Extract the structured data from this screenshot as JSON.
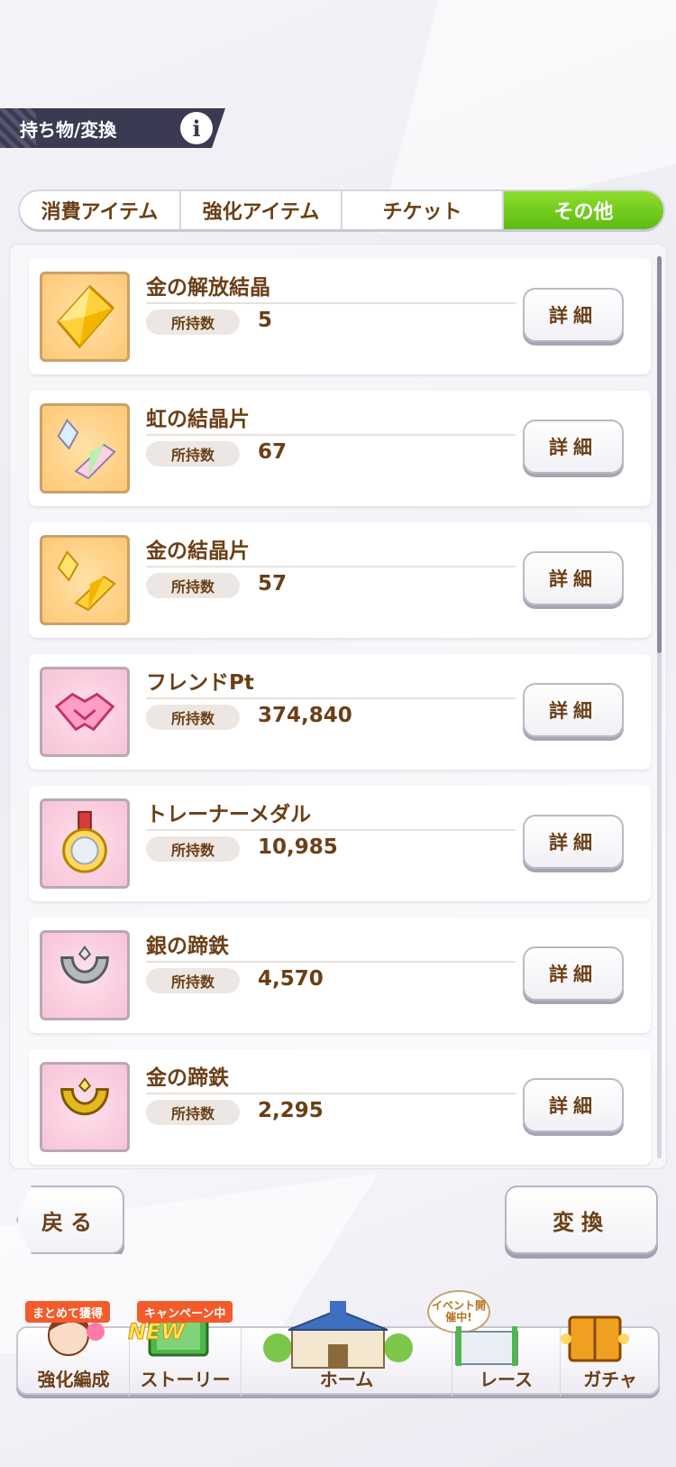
{
  "header": {
    "title": "持ち物/変換",
    "info_icon": "info-icon"
  },
  "tabs": [
    {
      "label": "消費アイテム",
      "active": false
    },
    {
      "label": "強化アイテム",
      "active": false
    },
    {
      "label": "チケット",
      "active": false
    },
    {
      "label": "その他",
      "active": true
    }
  ],
  "items": [
    {
      "name": "金の解放結晶",
      "qty_label": "所持数",
      "qty": "5",
      "icon": "gold-crystal-icon",
      "detail_label": "詳細"
    },
    {
      "name": "虹の結晶片",
      "qty_label": "所持数",
      "qty": "67",
      "icon": "rainbow-shard-icon",
      "detail_label": "詳細"
    },
    {
      "name": "金の結晶片",
      "qty_label": "所持数",
      "qty": "57",
      "icon": "gold-shard-icon",
      "detail_label": "詳細"
    },
    {
      "name": "フレンドPt",
      "qty_label": "所持数",
      "qty": "374,840",
      "icon": "handshake-icon",
      "detail_label": "詳細"
    },
    {
      "name": "トレーナーメダル",
      "qty_label": "所持数",
      "qty": "10,985",
      "icon": "medal-icon",
      "detail_label": "詳細"
    },
    {
      "name": "銀の蹄鉄",
      "qty_label": "所持数",
      "qty": "4,570",
      "icon": "silver-horseshoe-icon",
      "detail_label": "詳細"
    },
    {
      "name": "金の蹄鉄",
      "qty_label": "所持数",
      "qty": "2,295",
      "icon": "gold-horseshoe-icon",
      "detail_label": "詳細"
    }
  ],
  "actions": {
    "back_label": "戻る",
    "convert_label": "変換"
  },
  "nav": {
    "items": [
      {
        "label": "強化編成",
        "badge": "まとめて獲得"
      },
      {
        "label": "ストーリー",
        "badge": "キャンペーン中",
        "new_tag": "NEW"
      },
      {
        "label": "ホーム"
      },
      {
        "label": "レース",
        "bubble": "イベント開催中!"
      },
      {
        "label": "ガチャ"
      }
    ]
  },
  "colors": {
    "active_tab": "#5cbb12",
    "text_brown": "#6b3f16",
    "header_bg": "#3a3a52",
    "badge": "#f35b2a"
  }
}
